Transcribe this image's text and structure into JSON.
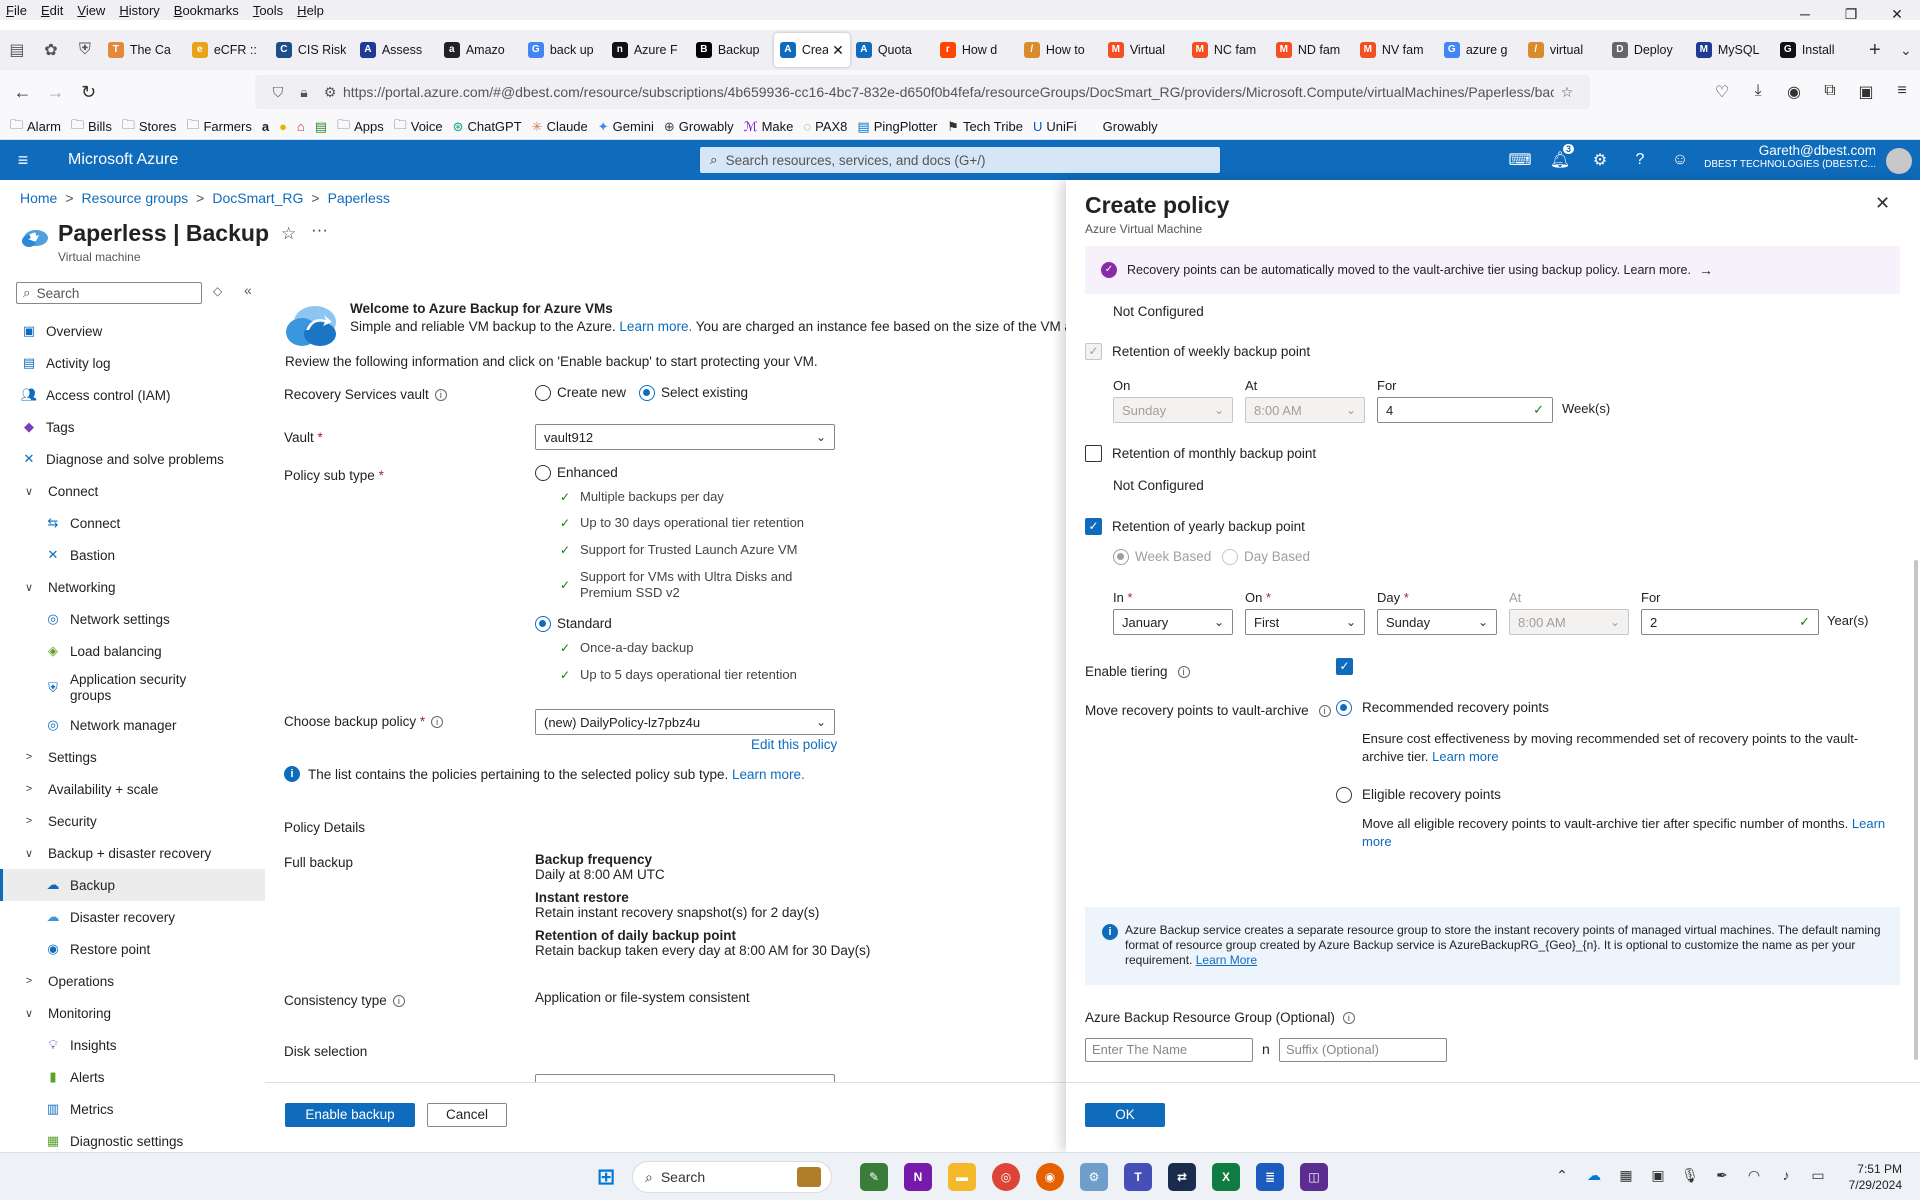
{
  "browser": {
    "menu": [
      "File",
      "Edit",
      "View",
      "History",
      "Bookmarks",
      "Tools",
      "Help"
    ],
    "tabs": [
      {
        "label": "The Ca",
        "color": "#e5883b",
        "glyph": "T"
      },
      {
        "label": "eCFR ::",
        "color": "#e8a317",
        "glyph": "e"
      },
      {
        "label": "CIS Risk",
        "color": "#1d4e89",
        "glyph": "C"
      },
      {
        "label": "Assess",
        "color": "#1f3a93",
        "glyph": "A"
      },
      {
        "label": "Amazo",
        "color": "#222222",
        "glyph": "a"
      },
      {
        "label": "back up",
        "color": "#4285f4",
        "glyph": "G"
      },
      {
        "label": "Azure F",
        "color": "#111111",
        "glyph": "n"
      },
      {
        "label": "Backup",
        "color": "#000000",
        "glyph": "B"
      },
      {
        "label": "Crea",
        "color": "#0f6cbd",
        "glyph": "A",
        "active": true
      },
      {
        "label": "Quota",
        "color": "#0f6cbd",
        "glyph": "A"
      },
      {
        "label": "How d",
        "color": "#ff4500",
        "glyph": "r"
      },
      {
        "label": "How to",
        "color": "#d98c2b",
        "glyph": "/"
      },
      {
        "label": "Virtual",
        "color": "#f25022",
        "glyph": "M"
      },
      {
        "label": "NC fam",
        "color": "#f25022",
        "glyph": "M"
      },
      {
        "label": "ND fam",
        "color": "#f25022",
        "glyph": "M"
      },
      {
        "label": "NV fam",
        "color": "#f25022",
        "glyph": "M"
      },
      {
        "label": "azure g",
        "color": "#4285f4",
        "glyph": "G"
      },
      {
        "label": "virtual",
        "color": "#d98c2b",
        "glyph": "/"
      },
      {
        "label": "Deploy",
        "color": "#666666",
        "glyph": "D"
      },
      {
        "label": "MySQL",
        "color": "#1f3a93",
        "glyph": "M"
      },
      {
        "label": "Install",
        "color": "#111111",
        "glyph": "G"
      }
    ],
    "url": "https://portal.azure.com/#@dbest.com/resource/subscriptions/4b659936-cc16-4bc7-832e-d650f0b4fefa/resourceGroups/DocSmart_RG/providers/Microsoft.Compute/virtualMachines/Paperless/backup",
    "bookmarks": [
      {
        "label": "Alarm",
        "icon": "folder"
      },
      {
        "label": "Bills",
        "icon": "folder"
      },
      {
        "label": "Stores",
        "icon": "folder"
      },
      {
        "label": "Farmers",
        "icon": "folder"
      },
      {
        "label": "Apps",
        "icon": "folder"
      },
      {
        "label": "Voice",
        "icon": "folder"
      },
      {
        "label": "ChatGPT",
        "icon": "chatgpt"
      },
      {
        "label": "Claude",
        "icon": "claude"
      },
      {
        "label": "Gemini",
        "icon": "gemini"
      },
      {
        "label": "Growably",
        "icon": "globe"
      },
      {
        "label": "Make",
        "icon": "make"
      },
      {
        "label": "PAX8",
        "icon": "pax8"
      },
      {
        "label": "PingPlotter",
        "icon": "ping"
      },
      {
        "label": "Tech Tribe",
        "icon": "tribe"
      },
      {
        "label": "UniFi",
        "icon": "unifi"
      },
      {
        "label": "Growably",
        "icon": "none"
      }
    ]
  },
  "azure": {
    "title": "Microsoft Azure",
    "search_placeholder": "Search resources, services, and docs (G+/)",
    "notification_count": "3",
    "user_name": "Gareth@dbest.com",
    "tenant": "DBEST TECHNOLOGIES (DBEST.C..."
  },
  "breadcrumb": [
    "Home",
    "Resource groups",
    "DocSmart_RG",
    "Paperless"
  ],
  "page": {
    "title": "Paperless | Backup",
    "subtitle": "Virtual machine",
    "search_placeholder": "Search"
  },
  "sidenav": [
    {
      "label": "Overview",
      "type": "item",
      "icon": "overview"
    },
    {
      "label": "Activity log",
      "type": "item",
      "icon": "activity"
    },
    {
      "label": "Access control (IAM)",
      "type": "item",
      "icon": "iam"
    },
    {
      "label": "Tags",
      "type": "item",
      "icon": "tag"
    },
    {
      "label": "Diagnose and solve problems",
      "type": "item",
      "icon": "diagnose"
    },
    {
      "label": "Connect",
      "type": "group",
      "expanded": true
    },
    {
      "label": "Connect",
      "type": "child",
      "icon": "connect"
    },
    {
      "label": "Bastion",
      "type": "child",
      "icon": "bastion"
    },
    {
      "label": "Networking",
      "type": "group",
      "expanded": true
    },
    {
      "label": "Network settings",
      "type": "child",
      "icon": "network"
    },
    {
      "label": "Load balancing",
      "type": "child",
      "icon": "lb"
    },
    {
      "label": "Application security groups",
      "type": "child",
      "icon": "asg",
      "tall": true
    },
    {
      "label": "Network manager",
      "type": "child",
      "icon": "netmgr"
    },
    {
      "label": "Settings",
      "type": "group",
      "expanded": false
    },
    {
      "label": "Availability + scale",
      "type": "group",
      "expanded": false
    },
    {
      "label": "Security",
      "type": "group",
      "expanded": false
    },
    {
      "label": "Backup + disaster recovery",
      "type": "group",
      "expanded": true
    },
    {
      "label": "Backup",
      "type": "child",
      "icon": "backup",
      "selected": true
    },
    {
      "label": "Disaster recovery",
      "type": "child",
      "icon": "dr"
    },
    {
      "label": "Restore point",
      "type": "child",
      "icon": "restore"
    },
    {
      "label": "Operations",
      "type": "group",
      "expanded": false
    },
    {
      "label": "Monitoring",
      "type": "group",
      "expanded": true
    },
    {
      "label": "Insights",
      "type": "child",
      "icon": "insights"
    },
    {
      "label": "Alerts",
      "type": "child",
      "icon": "alerts"
    },
    {
      "label": "Metrics",
      "type": "child",
      "icon": "metrics"
    },
    {
      "label": "Diagnostic settings",
      "type": "child",
      "icon": "diag"
    }
  ],
  "main": {
    "welcome_title": "Welcome to Azure Backup for Azure VMs",
    "welcome_desc": "Simple and reliable VM backup to the Azure.",
    "learn_more": "Learn more.",
    "welcome_desc2": "You are charged an instance fee based on the size of the VM and",
    "review": "Review the following information and click on 'Enable backup' to start protecting your VM.",
    "vault_label": "Recovery Services vault",
    "create_new": "Create new",
    "select_existing": "Select existing",
    "vault_field_label": "Vault",
    "vault_value": "vault912",
    "policy_subtype_label": "Policy sub type",
    "enhanced": "Enhanced",
    "enhanced_features": [
      "Multiple backups per day",
      "Up to 30 days operational tier retention",
      "Support for Trusted Launch Azure VM",
      "Support for VMs with Ultra Disks and Premium SSD v2"
    ],
    "standard": "Standard",
    "standard_features": [
      "Once-a-day backup",
      "Up to 5 days operational tier retention"
    ],
    "choose_policy_label": "Choose backup policy",
    "policy_value": "(new) DailyPolicy-lz7pbz4u",
    "edit_policy": "Edit this policy",
    "policy_info": "The list contains the policies pertaining to the selected policy sub type.",
    "policy_details": "Policy Details",
    "full_backup": "Full backup",
    "backup_frequency_head": "Backup frequency",
    "backup_frequency_val": "Daily at 8:00 AM UTC",
    "instant_restore_head": "Instant restore",
    "instant_restore_val": "Retain instant recovery snapshot(s) for 2 day(s)",
    "daily_retention_head": "Retention of daily backup point",
    "daily_retention_val": "Retain backup taken every day at 8:00 AM for 30 Day(s)",
    "consistency_label": "Consistency type",
    "consistency_val": "Application or file-system consistent",
    "disk_selection": "Disk selection",
    "enable_backup": "Enable backup",
    "cancel": "Cancel"
  },
  "blade": {
    "title": "Create policy",
    "subtitle": "Azure Virtual Machine",
    "banner": "Recovery points can be automatically moved to the vault-archive tier using backup policy. Learn more.",
    "not_configured_top": "Not Configured",
    "weekly_label": "Retention of weekly backup point",
    "weekly_checked": true,
    "on_label": "On",
    "on_value": "Sunday",
    "at_label": "At",
    "at_value": "8:00 AM",
    "for_label": "For",
    "weekly_for_value": "4",
    "weeks_unit": "Week(s)",
    "monthly_label": "Retention of monthly backup point",
    "monthly_checked": false,
    "not_configured_monthly": "Not Configured",
    "yearly_label": "Retention of yearly backup point",
    "yearly_checked": true,
    "week_based": "Week Based",
    "day_based": "Day Based",
    "in_label": "In",
    "in_value": "January",
    "on2_label": "On",
    "on2_value": "First",
    "day_label": "Day",
    "day_value": "Sunday",
    "at2_label": "At",
    "at2_value": "8:00 AM",
    "for2_label": "For",
    "yearly_for_value": "2",
    "years_unit": "Year(s)",
    "enable_tiering": "Enable tiering",
    "move_label": "Move recovery points to vault-archive",
    "recommended": "Recommended recovery points",
    "recommended_desc": "Ensure cost effectiveness by moving recommended set of recovery points to the vault-archive tier.",
    "learn_more": "Learn more",
    "eligible": "Eligible recovery points",
    "eligible_desc": "Move all eligible recovery points to vault-archive tier after specific number of months.",
    "info_box": "Azure Backup service creates a separate resource group to store the instant recovery points of managed virtual machines. The default naming format of resource group created by Azure Backup service is AzureBackupRG_{Geo}_{n}. It is optional to customize the name as per your requirement.",
    "learn_more_cap": "Learn More",
    "rg_label": "Azure Backup Resource Group (Optional)",
    "rg_name_placeholder": "Enter The Name",
    "rg_n": "n",
    "rg_suffix_placeholder": "Suffix (Optional)",
    "ok": "OK"
  },
  "taskbar": {
    "search": "Search",
    "time": "7:51 PM",
    "date": "7/29/2024"
  },
  "colors": {
    "accent": "#0f6cbd",
    "success": "#107c10",
    "banner_bg": "#f7f1fb",
    "info_bg": "#eef4fc"
  }
}
